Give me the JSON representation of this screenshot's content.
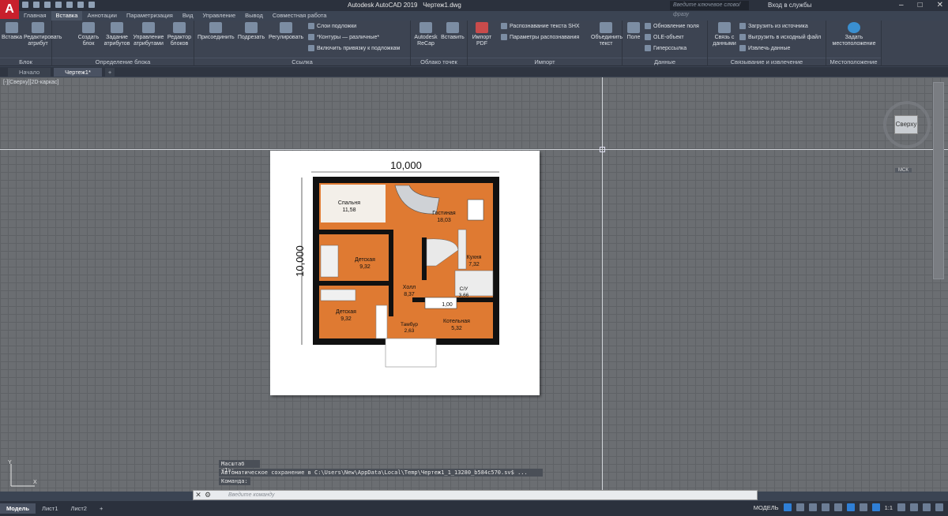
{
  "app": {
    "title": "Autodesk AutoCAD 2019",
    "file": "Чертеж1.dwg",
    "logo": "A",
    "search_placeholder": "Введите ключевое слово/фразу",
    "signin": "Вход в службы"
  },
  "tabs": [
    "Главная",
    "Вставка",
    "Аннотации",
    "Параметризация",
    "Вид",
    "Управление",
    "Вывод",
    "Совместная работа"
  ],
  "active_tab": "Вставка",
  "ribbon": {
    "block": {
      "label": "Блок",
      "buttons": [
        "Вставка",
        "Редактировать атрибут"
      ]
    },
    "block_def": {
      "label": "Определение блока",
      "buttons": [
        "Создать блок",
        "Задание атрибутов",
        "Управление атрибутами",
        "Редактор блоков"
      ]
    },
    "reference": {
      "label": "Ссылка",
      "buttons": [
        "Присоединить",
        "Подрезать",
        "Регулировать"
      ],
      "small": [
        "Слои подложки",
        "*Контуры — различные*",
        "Включить привязку к подложкам"
      ]
    },
    "cloud": {
      "label": "Облако точек",
      "buttons": [
        "Autodesk ReCap",
        "Вставить"
      ]
    },
    "import": {
      "label": "Импорт",
      "buttons": [
        "Импорт PDF"
      ],
      "small": [
        "Распознавание текста SHX",
        "Параметры распознавания"
      ],
      "big2": "Объединить текст"
    },
    "data": {
      "label": "Данные",
      "buttons": [
        "Поле"
      ],
      "small": [
        "Обновление поля",
        "OLE-объект",
        "Гиперссылка"
      ]
    },
    "link": {
      "label": "Связывание и извлечение",
      "buttons": [
        "Связь с данными"
      ],
      "small": [
        "Загрузить из источника",
        "Выгрузить в исходный файл",
        "Извлечь данные"
      ]
    },
    "location": {
      "label": "Местоположение",
      "buttons": [
        "Задать местоположение"
      ]
    }
  },
  "doc_tabs": [
    "Начало",
    "Чертеж1*"
  ],
  "viewport_label": "[-][Сверху][2D-каркас]",
  "viewcube": {
    "face": "Сверху",
    "wcs": "МСК"
  },
  "plan": {
    "dim_top": "10,000",
    "dim_left": "10,000",
    "rooms": [
      {
        "name": "Спальня",
        "area": "11,58"
      },
      {
        "name": "Гостиная",
        "area": "18,03"
      },
      {
        "name": "Детская",
        "area": "9,32"
      },
      {
        "name": "Кухня",
        "area": "7,32"
      },
      {
        "name": "Холл",
        "area": "8,37"
      },
      {
        "name": "С/У",
        "area": "3,66"
      },
      {
        "name": "Детская",
        "area": "9,32"
      },
      {
        "name": "Тамбур",
        "area": "2,63"
      },
      {
        "name": "Котельная",
        "area": "5,32"
      },
      {
        "name": "",
        "area": "1,00"
      }
    ]
  },
  "command": {
    "history": [
      "Масштаб <1>:",
      "Автоматическое сохранение в C:\\Users\\New\\AppData\\Local\\Temp\\Чертеж1_1_13280_b584c570.sv$ ...",
      "Команда:"
    ],
    "placeholder": "Введите команду"
  },
  "layout_tabs": [
    "Модель",
    "Лист1",
    "Лист2"
  ],
  "status": {
    "model": "МОДЕЛЬ",
    "scale": "1:1"
  },
  "colors": {
    "accent": "#2f7fd6",
    "floor": "#e07b32",
    "wall": "#111111",
    "brand": "#c8202c"
  }
}
